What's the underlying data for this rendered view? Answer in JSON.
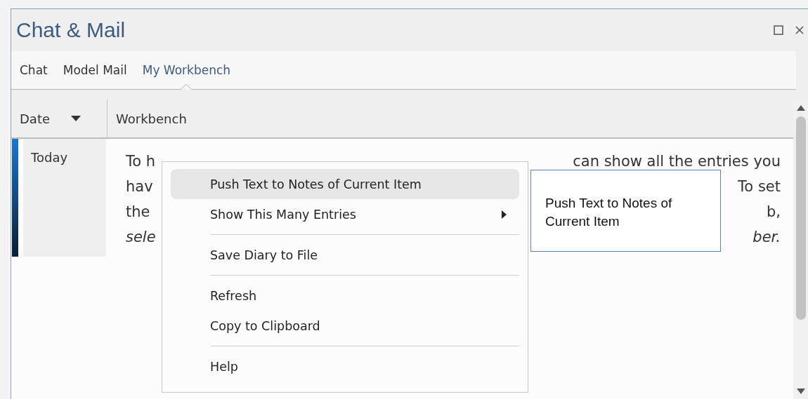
{
  "window": {
    "title": "Chat & Mail"
  },
  "tabs": [
    {
      "label": "Chat",
      "selected": false
    },
    {
      "label": "Model Mail",
      "selected": false
    },
    {
      "label": "My Workbench",
      "selected": true
    }
  ],
  "table": {
    "columns": [
      "Date",
      "Workbench"
    ],
    "rows": [
      {
        "date": "Today",
        "lines": [
          {
            "left": "To h",
            "right": "can show all the entries you",
            "italic": false
          },
          {
            "left": "hav",
            "right": "To set",
            "italic": false
          },
          {
            "left": "the",
            "right": "b,",
            "italic": false
          },
          {
            "left": "sele",
            "right": "ber.",
            "italic": true
          }
        ]
      }
    ]
  },
  "context_menu": {
    "items": [
      {
        "kind": "item",
        "label": "Push Text to Notes of Current Item",
        "selected": true,
        "submenu": false
      },
      {
        "kind": "item",
        "label": "Show This Many Entries",
        "selected": false,
        "submenu": true
      },
      {
        "kind": "separator"
      },
      {
        "kind": "item",
        "label": "Save Diary to File",
        "selected": false,
        "submenu": false
      },
      {
        "kind": "separator"
      },
      {
        "kind": "item",
        "label": "Refresh",
        "selected": false,
        "submenu": false
      },
      {
        "kind": "item",
        "label": "Copy to Clipboard",
        "selected": false,
        "submenu": false
      },
      {
        "kind": "separator"
      },
      {
        "kind": "item",
        "label": "Help",
        "selected": false,
        "submenu": false
      }
    ]
  },
  "tooltip": {
    "text": "Push Text to Notes of Current Item"
  }
}
